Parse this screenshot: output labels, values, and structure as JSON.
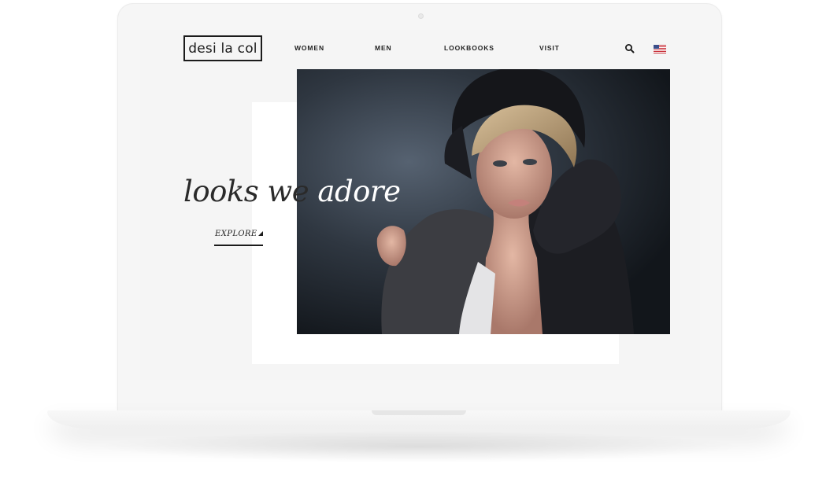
{
  "header": {
    "logo_text": "desi la col",
    "nav": [
      {
        "label": "WOMEN"
      },
      {
        "label": "MEN"
      },
      {
        "label": "LOOKBOOKS"
      },
      {
        "label": "VISIT"
      }
    ],
    "search_icon": "search-icon",
    "locale_icon": "us-flag-icon"
  },
  "hero": {
    "headline_dark": "looks we",
    "headline_light": "adore",
    "cta_label": "EXPLORE",
    "photo": "fashion model portrait"
  },
  "colors": {
    "ink": "#1b1b1b",
    "screen_background": "#f5f5f5",
    "panel": "#ffffff"
  }
}
